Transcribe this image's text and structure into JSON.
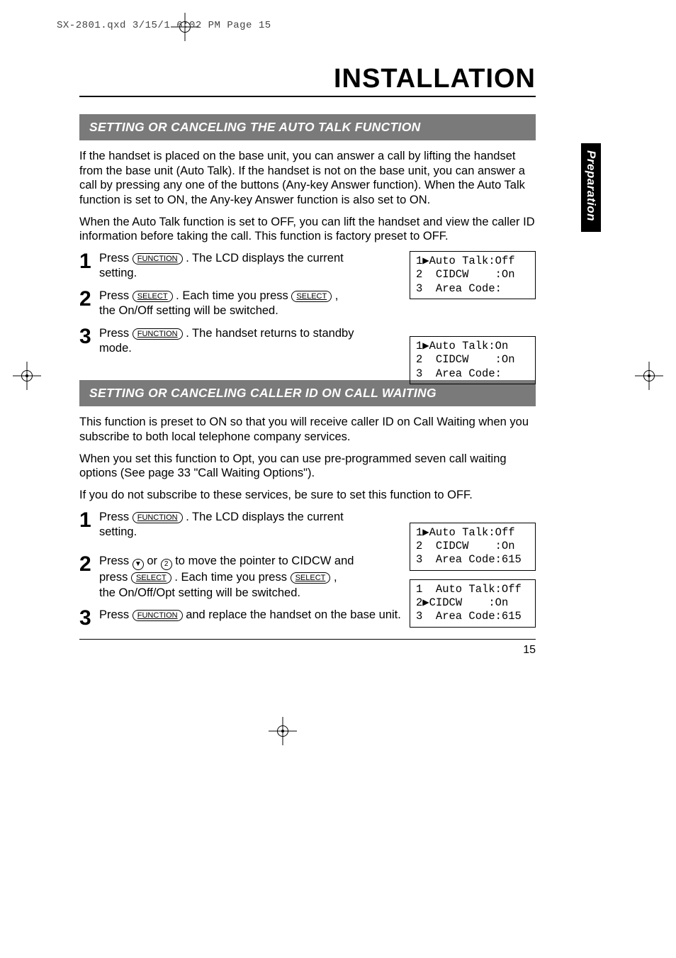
{
  "prepress_header": "SX-2801.qxd  3/15/1 6:02 PM  Page 15",
  "sidetab": "Preparation",
  "title": "INSTALLATION",
  "sectionA": {
    "heading": "SETTING OR CANCELING THE AUTO TALK FUNCTION",
    "p1": "If the handset is placed on the base unit, you can answer a call by lifting the handset from the base unit (Auto Talk).  If the handset is not on the base unit, you can answer a call by pressing any one of the buttons (Any-key Answer function). When the Auto Talk function is set to ON, the Any-key Answer function is also set to ON.",
    "p2": "When the Auto Talk function is set to OFF, you can lift the handset and view the caller ID information before taking the call.  This function is factory preset to OFF.",
    "step1_a": "Press ",
    "step1_b": " .  The LCD displays the current setting.",
    "step2_a": "Press ",
    "step2_b": ". Each time you press ",
    "step2_c": ", the On/Off setting will be switched.",
    "step3_a": "Press ",
    "step3_b": " .  The handset returns to standby mode.",
    "lcd1": "1▶Auto Talk:Off\n2  CIDCW    :On\n3  Area Code:",
    "lcd2": "1▶Auto Talk:On\n2  CIDCW    :On\n3  Area Code:"
  },
  "sectionB": {
    "heading": "SETTING OR CANCELING CALLER ID ON CALL WAITING",
    "p1": "This function is preset to ON so that you will receive caller ID on Call Waiting when you subscribe to both local telephone company services.",
    "p2": "When you set this function to Opt, you can use pre-programmed seven call waiting options (See page 33 \"Call Waiting Options\").",
    "p3": "If you do not subscribe to these services, be sure to set this function to OFF.",
    "step1_a": "Press ",
    "step1_b": " . The LCD displays the current setting.",
    "step2_a": "Press ",
    "step2_b": " or ",
    "step2_c": " to move the pointer to CIDCW and press ",
    "step2_d": ".  Each time you press ",
    "step2_e": ", the On/Off/Opt setting will be switched.",
    "step3_a": "Press ",
    "step3_b": "  and replace the handset on the base unit.",
    "lcd1": "1▶Auto Talk:Off\n2  CIDCW    :On\n3  Area Code:615",
    "lcd2": "1  Auto Talk:Off\n2▶CIDCW    :On\n3  Area Code:615"
  },
  "btn": {
    "function": "FUNCTION",
    "select": "SELECT",
    "down": "▼",
    "two": "2"
  },
  "page_number": "15"
}
